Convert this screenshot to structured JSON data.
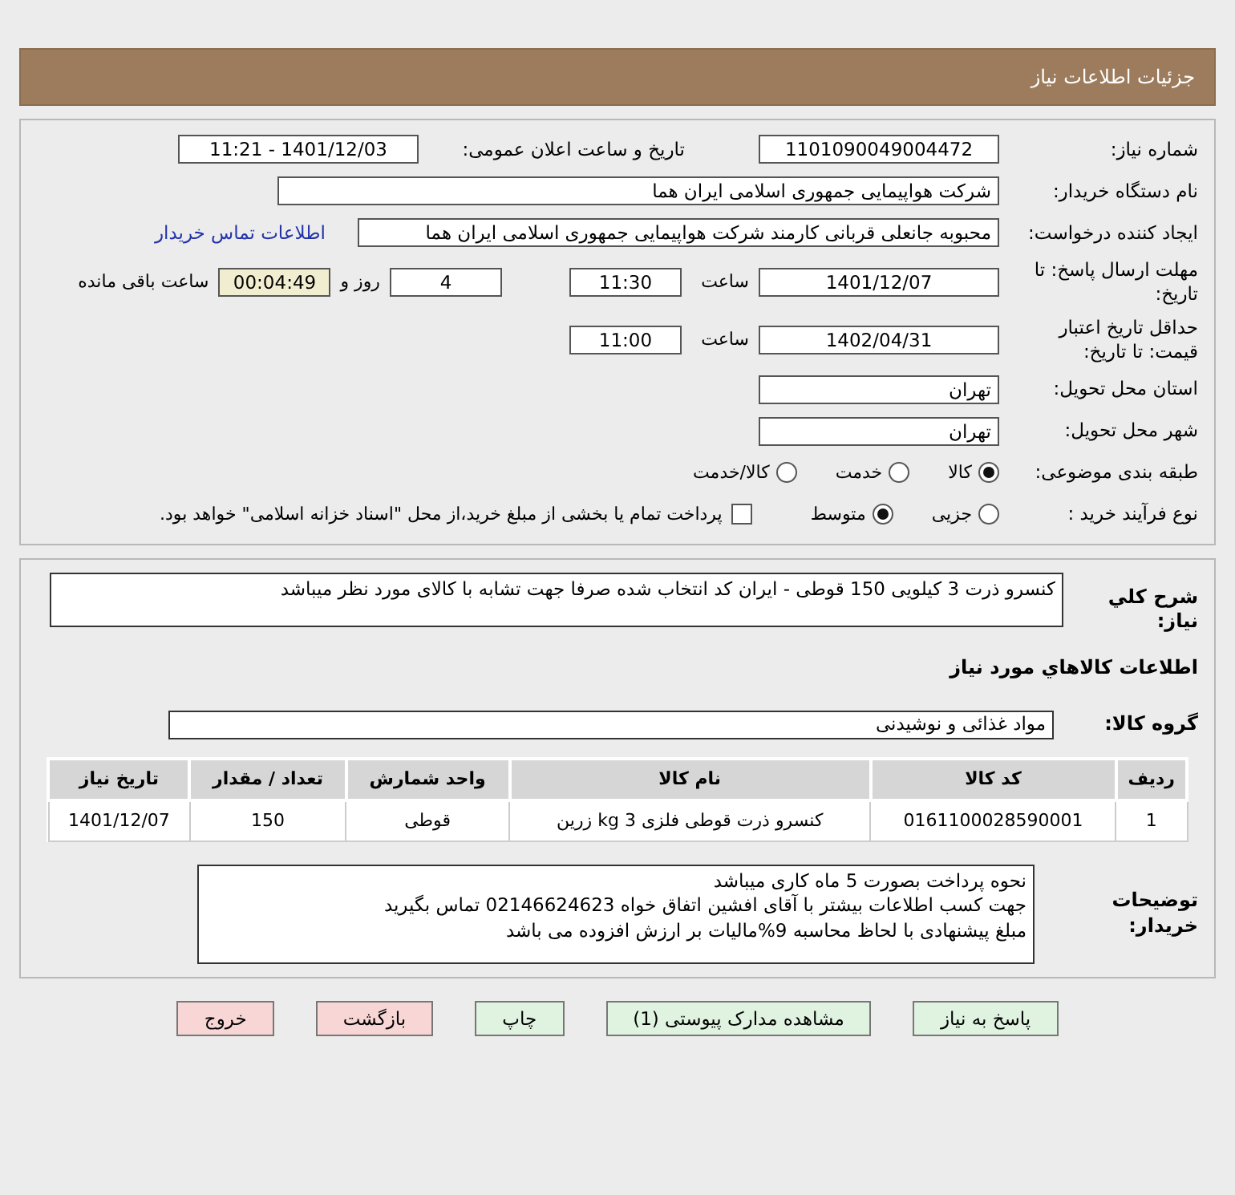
{
  "header": {
    "title": "جزئیات اطلاعات نیاز"
  },
  "need_number": {
    "label": "شماره نیاز:",
    "value": "1101090049004472"
  },
  "announce": {
    "label": "تاریخ و ساعت اعلان عمومی:",
    "value": "1401/12/03 - 11:21"
  },
  "buyer": {
    "label": "نام دستگاه خریدار:",
    "value": "شرکت هواپیمایی جمهوری اسلامی ایران هما"
  },
  "creator": {
    "label": "ایجاد کننده درخواست:",
    "value": "محبوبه جانعلی قربانی کارمند شرکت هواپیمایی جمهوری اسلامی ایران هما",
    "link": "اطلاعات تماس خریدار"
  },
  "deadline": {
    "label": "مهلت ارسال پاسخ: تا تاریخ:",
    "date": "1401/12/07",
    "time_label": "ساعت",
    "time": "11:30",
    "days": "4",
    "days_label": "روز و",
    "remaining": "00:04:49",
    "remaining_label": "ساعت باقی مانده"
  },
  "validity": {
    "label": "حداقل تاریخ اعتبار قیمت: تا تاریخ:",
    "date": "1402/04/31",
    "time_label": "ساعت",
    "time": "11:00"
  },
  "province": {
    "label": "استان محل تحویل:",
    "value": "تهران"
  },
  "city": {
    "label": "شهر محل تحویل:",
    "value": "تهران"
  },
  "category": {
    "label": "طبقه بندی موضوعی:",
    "options": [
      {
        "label": "کالا",
        "selected": true
      },
      {
        "label": "خدمت",
        "selected": false
      },
      {
        "label": "کالا/خدمت",
        "selected": false
      }
    ]
  },
  "process": {
    "label": "نوع فرآیند خرید :",
    "options": [
      {
        "label": "جزیی",
        "selected": false
      },
      {
        "label": "متوسط",
        "selected": true
      }
    ],
    "treasury": {
      "checked": false,
      "text": "پرداخت تمام یا بخشی از مبلغ خرید،از محل \"اسناد خزانه اسلامی\" خواهد بود."
    }
  },
  "summary": {
    "label": "شرح کلي نياز:",
    "value": "کنسرو ذرت 3 کیلویی  150 قوطی - ایران کد انتخاب شده صرفا جهت تشابه با کالای مورد نظر میباشد"
  },
  "goods_heading": "اطلاعات کالاهاي مورد نياز",
  "goods_group": {
    "label": "گروه کالا:",
    "value": "مواد غذائی و نوشیدنی"
  },
  "table": {
    "columns": [
      "ردیف",
      "کد کالا",
      "نام کالا",
      "واحد شمارش",
      "تعداد / مقدار",
      "تاریخ نیاز"
    ],
    "rows": [
      [
        "1",
        "0161100028590001",
        "کنسرو ذرت قوطی فلزی 3 kg زرین",
        "قوطی",
        "150",
        "1401/12/07"
      ]
    ]
  },
  "notes": {
    "label": "توضیحات خریدار:",
    "lines": [
      "نحوه پرداخت بصورت 5 ماه کاری میباشد",
      "جهت کسب اطلاعات بیشتر با آقای افشین اتفاق خواه  02146624623 تماس بگیرید",
      "مبلغ پیشنهادی با لحاظ محاسبه 9%مالیات بر ارزش افزوده می باشد"
    ]
  },
  "buttons": [
    {
      "label": "پاسخ به نیاز",
      "kind": "normal"
    },
    {
      "label": "مشاهده مدارک پیوستی (1)",
      "kind": "normal"
    },
    {
      "label": "چاپ",
      "kind": "normal"
    },
    {
      "label": "بازگشت",
      "kind": "danger"
    },
    {
      "label": "خروج",
      "kind": "danger"
    }
  ]
}
